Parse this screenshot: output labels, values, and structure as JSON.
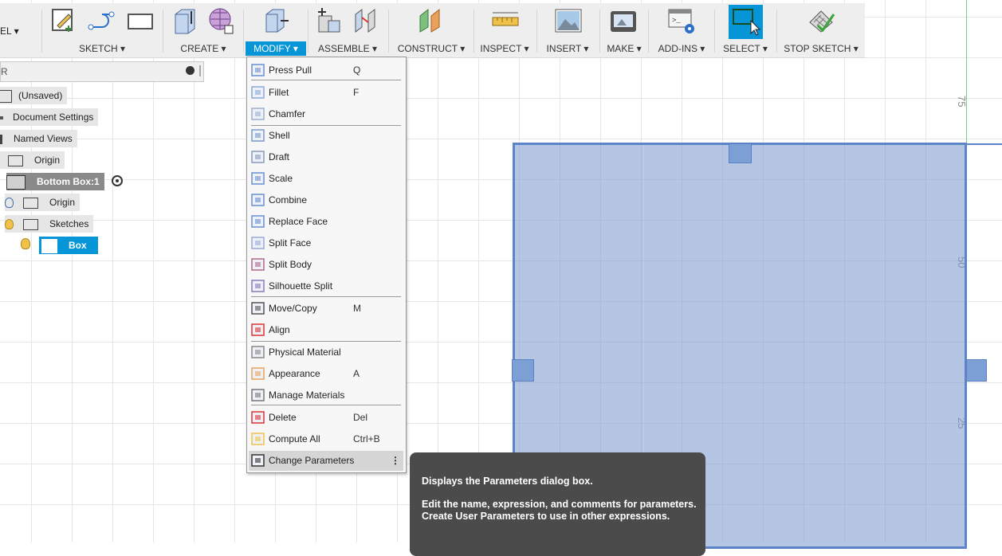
{
  "toolbar": {
    "workspace": "EL ▾",
    "groups": {
      "sketch": "SKETCH ▾",
      "create": "CREATE ▾",
      "modify": "MODIFY ▾",
      "assemble": "ASSEMBLE ▾",
      "construct": "CONSTRUCT ▾",
      "inspect": "INSPECT ▾",
      "insert": "INSERT ▾",
      "make": "MAKE ▾",
      "addins": "ADD-INS ▾",
      "select": "SELECT ▾",
      "stop_sketch": "STOP SKETCH ▾"
    },
    "active_color": "#0696d7"
  },
  "browser": {
    "search_text": "R",
    "nodes": {
      "unsaved": "(Unsaved)",
      "doc_settings": "Document Settings",
      "named_views": "Named Views",
      "origin_root": "Origin",
      "bottom_box": "Bottom Box:1",
      "origin_comp": "Origin",
      "sketches": "Sketches",
      "box": "Box"
    }
  },
  "menu": {
    "items": [
      {
        "label": "Press Pull",
        "key": "Q",
        "icon": "press-pull-icon"
      },
      {
        "label": "Fillet",
        "key": "F",
        "icon": "fillet-icon"
      },
      {
        "label": "Chamfer",
        "key": "",
        "icon": "chamfer-icon"
      },
      {
        "label": "Shell",
        "key": "",
        "icon": "shell-icon"
      },
      {
        "label": "Draft",
        "key": "",
        "icon": "draft-icon"
      },
      {
        "label": "Scale",
        "key": "",
        "icon": "scale-icon"
      },
      {
        "label": "Combine",
        "key": "",
        "icon": "combine-icon"
      },
      {
        "label": "Replace Face",
        "key": "",
        "icon": "replace-face-icon"
      },
      {
        "label": "Split Face",
        "key": "",
        "icon": "split-face-icon"
      },
      {
        "label": "Split Body",
        "key": "",
        "icon": "split-body-icon"
      },
      {
        "label": "Silhouette Split",
        "key": "",
        "icon": "silhouette-split-icon"
      },
      {
        "label": "Move/Copy",
        "key": "M",
        "icon": "move-copy-icon"
      },
      {
        "label": "Align",
        "key": "",
        "icon": "align-icon"
      },
      {
        "label": "Physical Material",
        "key": "",
        "icon": "physical-material-icon"
      },
      {
        "label": "Appearance",
        "key": "A",
        "icon": "appearance-icon"
      },
      {
        "label": "Manage Materials",
        "key": "",
        "icon": "manage-materials-icon"
      },
      {
        "label": "Delete",
        "key": "Del",
        "icon": "delete-icon"
      },
      {
        "label": "Compute All",
        "key": "Ctrl+B",
        "icon": "compute-all-icon"
      },
      {
        "label": "Change Parameters",
        "key": "",
        "icon": "change-parameters-icon"
      }
    ]
  },
  "tooltip": {
    "line1": "Displays the Parameters dialog box.",
    "line2": "Edit the name, expression, and comments for parameters. Create User Parameters to use in other expressions."
  },
  "ruler": {
    "labels": [
      "75",
      "50",
      "25"
    ]
  }
}
